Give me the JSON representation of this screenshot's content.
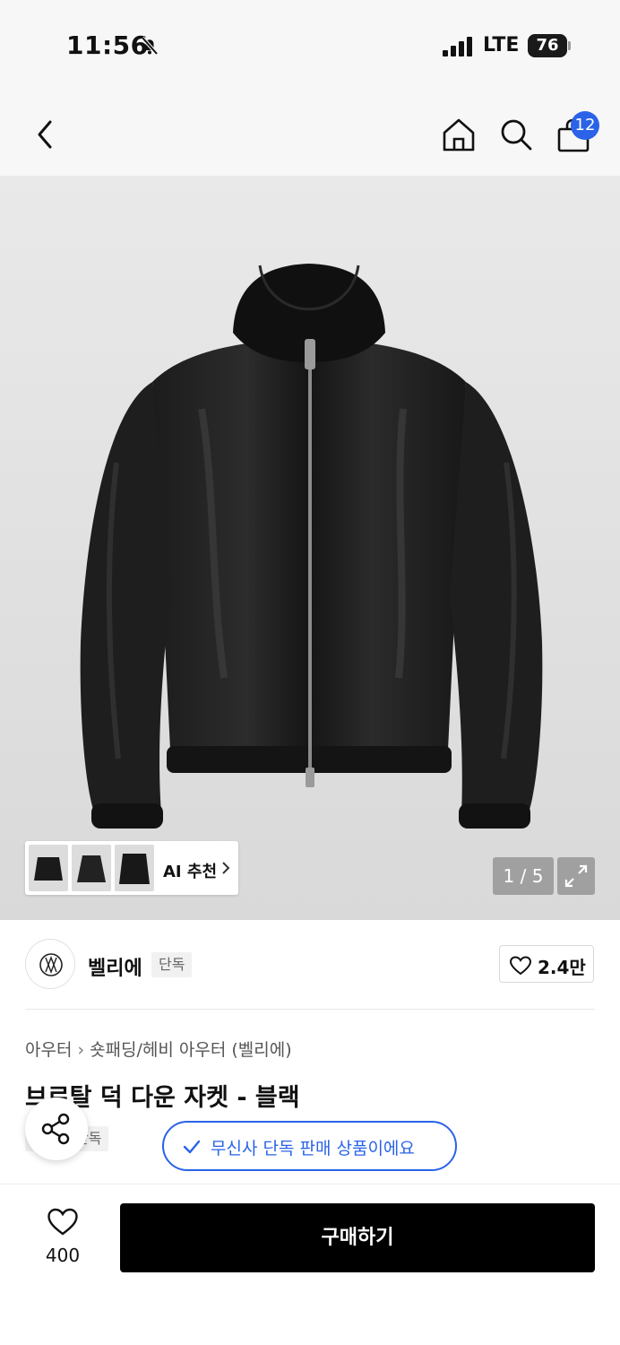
{
  "status_bar": {
    "time": "11:56",
    "network": "LTE",
    "battery": "76"
  },
  "header": {
    "cart_count": "12"
  },
  "gallery": {
    "ai_label": "AI 추천",
    "counter": "1 / 5"
  },
  "brand": {
    "name": "벨리에",
    "exclusive_tag": "단독",
    "like_count": "2.4만"
  },
  "product": {
    "breadcrumb": [
      "아우터",
      "숏패딩/헤비 아우터 (벨리에)"
    ],
    "title": "브르탈 덕 다운 자켓 - 블랙",
    "tag": "단독"
  },
  "toast": {
    "text": "무신사 단독 판매 상품이에요"
  },
  "bottom_bar": {
    "like_count": "400",
    "buy_label": "구매하기"
  },
  "colors": {
    "accent": "#2a63e8",
    "buy_button": "#000000"
  }
}
